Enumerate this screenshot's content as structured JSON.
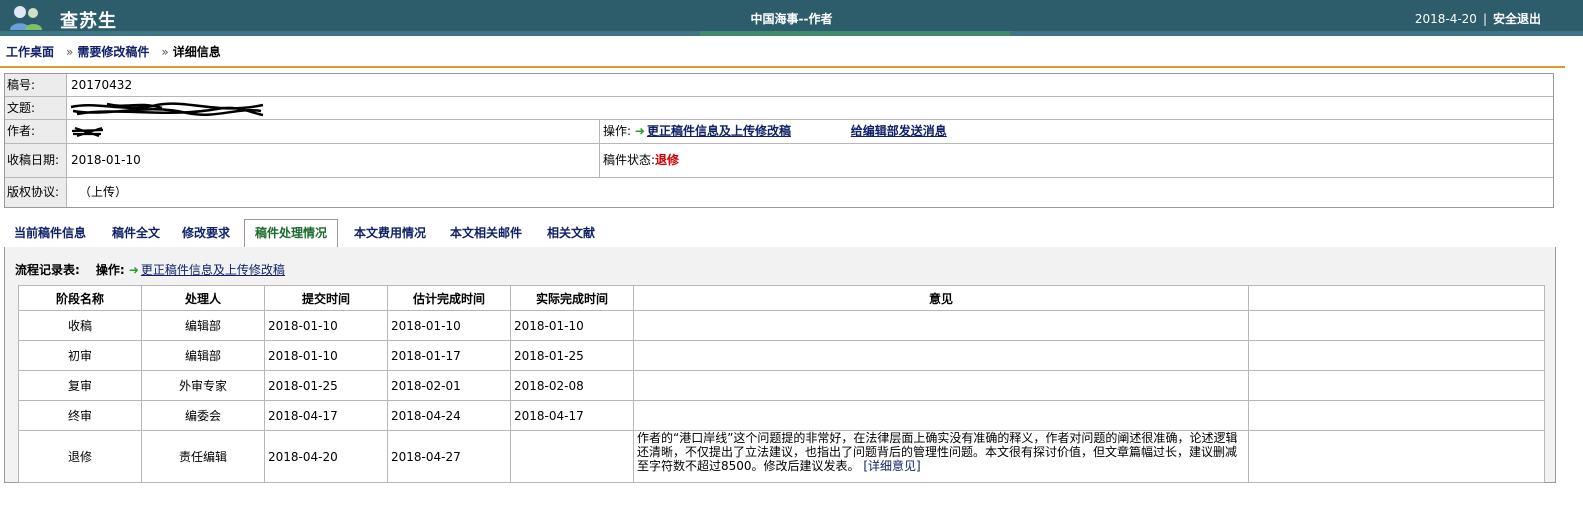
{
  "header": {
    "user_name": "查苏生",
    "system_title": "中国海事--作者",
    "date": "2018-4-20",
    "divider": "|",
    "logout_label": "安全退出"
  },
  "breadcrumb": {
    "home": "工作桌面",
    "arrow1": "»",
    "section": "需要修改稿件",
    "arrow2": "»",
    "current": "详细信息"
  },
  "info": {
    "manuscript_no_label": "稿号:",
    "manuscript_no": "20170432",
    "title_label": "文题:",
    "author_label": "作者:",
    "received_label": "收稿日期:",
    "received_date": "2018-01-10",
    "copyright_label": "版权协议:",
    "copyright_value": "（上传）",
    "operation_label": "操作:",
    "update_link": "更正稿件信息及上传修改稿",
    "message_link": "给编辑部发送消息",
    "status_label": "稿件状态:",
    "status_value": "退修"
  },
  "tabs": [
    {
      "label": "当前稿件信息"
    },
    {
      "label": "稿件全文"
    },
    {
      "label": "修改要求"
    },
    {
      "label": "稿件处理情况"
    },
    {
      "label": "本文费用情况"
    },
    {
      "label": "本文相关邮件"
    },
    {
      "label": "相关文献"
    }
  ],
  "flow": {
    "heading": "流程记录表:",
    "operation_label": "操作:",
    "update_link": "更正稿件信息及上传修改稿",
    "columns": [
      "阶段名称",
      "处理人",
      "提交时间",
      "估计完成时间",
      "实际完成时间",
      "意见"
    ],
    "rows": [
      {
        "stage": "收稿",
        "handler": "编辑部",
        "submit": "2018-01-10",
        "estimate": "2018-01-10",
        "actual": "2018-01-10",
        "opinion": ""
      },
      {
        "stage": "初审",
        "handler": "编辑部",
        "submit": "2018-01-10",
        "estimate": "2018-01-17",
        "actual": "2018-01-25",
        "opinion": ""
      },
      {
        "stage": "复审",
        "handler": "外审专家",
        "submit": "2018-01-25",
        "estimate": "2018-02-01",
        "actual": "2018-02-08",
        "opinion": ""
      },
      {
        "stage": "终审",
        "handler": "编委会",
        "submit": "2018-04-17",
        "estimate": "2018-04-24",
        "actual": "2018-04-17",
        "opinion": ""
      },
      {
        "stage": "退修",
        "handler": "责任编辑",
        "submit": "2018-04-20",
        "estimate": "2018-04-27",
        "actual": "",
        "opinion": "作者的“港口岸线”这个问题提的非常好，在法律层面上确实没有准确的释义，作者对问题的阐述很准确，论述逻辑还清晰，不仅提出了立法建议，也指出了问题背后的管理性问题。本文很有探讨价值，但文章篇幅过长，建议删减至字符数不超过8500。修改后建议发表。",
        "detail_link": "[详细意见]"
      }
    ]
  }
}
